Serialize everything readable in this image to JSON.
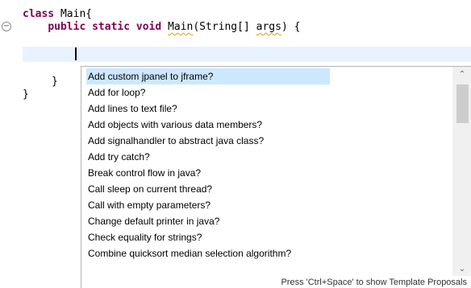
{
  "editor": {
    "class_keyword": "class",
    "class_name": " Main{",
    "method_indent": "    ",
    "method_keywords": "public static void",
    "method_space": " ",
    "method_name": "Main",
    "method_params_open": "(String[] ",
    "method_param_name": "args",
    "method_params_close": ") {",
    "closing_brace_method": "}",
    "closing_brace_class": "}"
  },
  "autocomplete": {
    "items": [
      "Add custom jpanel to jframe?",
      "Add for loop?",
      "Add lines to text file?",
      "Add objects with various data members?",
      "Add signalhandler to abstract java class?",
      "Add try catch?",
      "Break control flow in java?",
      "Call sleep on current thread?",
      "Call with empty parameters?",
      "Change default printer in java?",
      "Check equality for strings?",
      "Combine quicksort median selection algorithm?"
    ],
    "selected_index": 0,
    "footer": "Press 'Ctrl+Space' to show Template Proposals"
  },
  "icons": {
    "fold": "collapse-icon",
    "scroll_up": "chevron-up-icon",
    "scroll_down": "chevron-down-icon"
  },
  "colors": {
    "keyword": "#7f0055",
    "selection": "#cce8ff",
    "current_line": "#e8f2fe"
  }
}
